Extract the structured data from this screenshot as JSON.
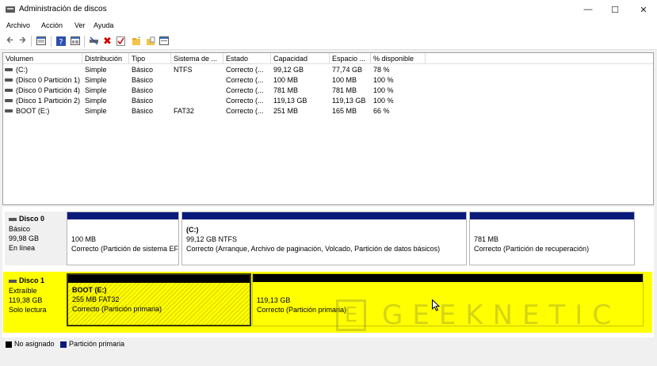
{
  "window": {
    "title": "Administración de discos"
  },
  "menu": [
    "Archivo",
    "Acción",
    "Ver",
    "Ayuda"
  ],
  "columns": [
    "Volumen",
    "Distribución",
    "Tipo",
    "Sistema de ...",
    "Estado",
    "Capacidad",
    "Espacio ...",
    "% disponible"
  ],
  "volumes": [
    [
      "(C:)",
      "Simple",
      "Básico",
      "NTFS",
      "Correcto (...",
      "99,12 GB",
      "77,74 GB",
      "78 %"
    ],
    [
      "(Disco 0 Partición 1)",
      "Simple",
      "Básico",
      "",
      "Correcto (...",
      "100 MB",
      "100 MB",
      "100 %"
    ],
    [
      "(Disco 0 Partición 4)",
      "Simple",
      "Básico",
      "",
      "Correcto (...",
      "781 MB",
      "781 MB",
      "100 %"
    ],
    [
      "(Disco 1 Partición 2)",
      "Simple",
      "Básico",
      "",
      "Correcto (...",
      "119,13 GB",
      "119,13 GB",
      "100 %"
    ],
    [
      "BOOT (E:)",
      "Simple",
      "Básico",
      "FAT32",
      "Correcto (...",
      "251 MB",
      "165 MB",
      "66 %"
    ]
  ],
  "disk0": {
    "name": "Disco 0",
    "type": "Básico",
    "size": "99,98 GB",
    "status": "En línea",
    "partitions": [
      {
        "title": "",
        "size": "100 MB",
        "status": "Correcto (Partición de sistema EF"
      },
      {
        "title": "(C:)",
        "size": "99,12 GB NTFS",
        "status": "Correcto (Arranque, Archivo de paginación, Volcado, Partición de datos básicos)"
      },
      {
        "title": "",
        "size": "781 MB",
        "status": "Correcto (Partición de recuperación)"
      }
    ]
  },
  "disk1": {
    "name": "Disco 1",
    "type": "Extraíble",
    "size": "119,38 GB",
    "status": "Solo lectura",
    "partitions": [
      {
        "title": "BOOT  (E:)",
        "size": "255 MB FAT32",
        "status": "Correcto (Partición primaria)"
      },
      {
        "title": "",
        "size": "119,13 GB",
        "status": "Correcto (Partición primaria)"
      }
    ]
  },
  "legend": {
    "unallocated": "No asignado",
    "primary": "Partición primaria"
  },
  "watermark": {
    "mark": "E",
    "text": "GEEKNETIC"
  },
  "colors": {
    "partition_bar": "#0a1a7a",
    "unallocated": "#000000",
    "highlight": "#ffff00"
  },
  "icons": [
    "back-icon",
    "forward-icon",
    "properties-icon",
    "help-icon",
    "connect-icon",
    "delete-icon",
    "check-icon",
    "folder-icon",
    "open-icon",
    "format-icon"
  ]
}
